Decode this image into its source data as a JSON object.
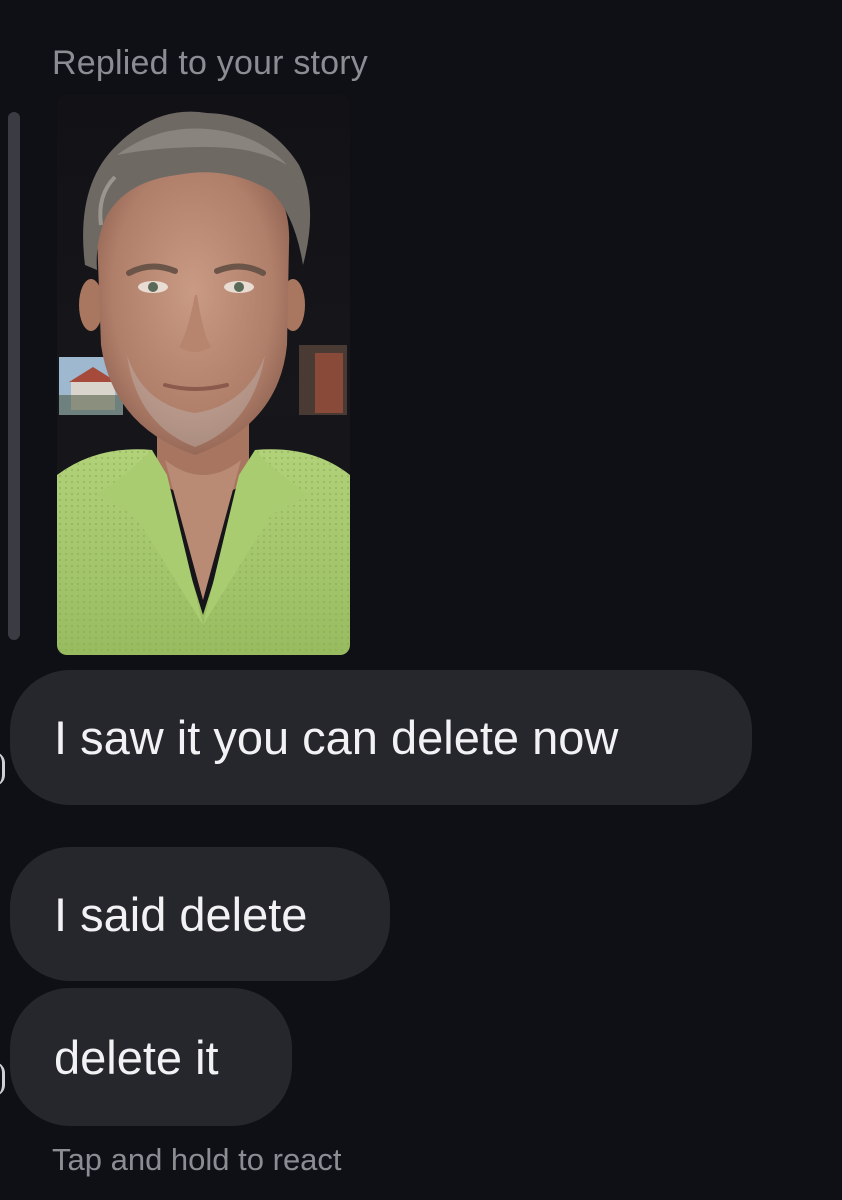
{
  "thread": {
    "reply_context": "Replied to your story",
    "story_image": "story-selfie-photo",
    "messages": [
      {
        "text": "I saw it you can delete now"
      },
      {
        "text": "I said delete"
      },
      {
        "text": "delete it"
      }
    ],
    "hint": "Tap and hold to react"
  },
  "colors": {
    "background": "#0f1016",
    "bubble": "#26272d",
    "muted_text": "#8c8d94",
    "message_text": "#f2f2f5",
    "shirt": "#a4c56c"
  }
}
